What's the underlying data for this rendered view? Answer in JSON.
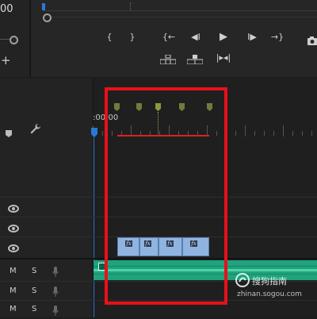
{
  "monitor": {
    "timecode_fragment": "00",
    "add_label": "+",
    "controls": {
      "mark_in": "{",
      "mark_out": "}",
      "go_to_in": "{←",
      "step_back": "◀I",
      "play": "▶",
      "step_forward": "I▶",
      "go_to_out": "→}"
    }
  },
  "timeline": {
    "ruler_start": ":00:00",
    "tracks": {
      "mute_label": "M",
      "solo_label": "S"
    }
  },
  "watermark": {
    "brand": "搜狗指南",
    "url": "zhinan.sogou.com"
  },
  "colors": {
    "highlight": "#e8101a",
    "playhead": "#2b78d4",
    "marker": "#6f7c3a",
    "work_area": "#e02020",
    "video_clip": "#90b4e0",
    "audio_clip": "#1fa37c"
  }
}
